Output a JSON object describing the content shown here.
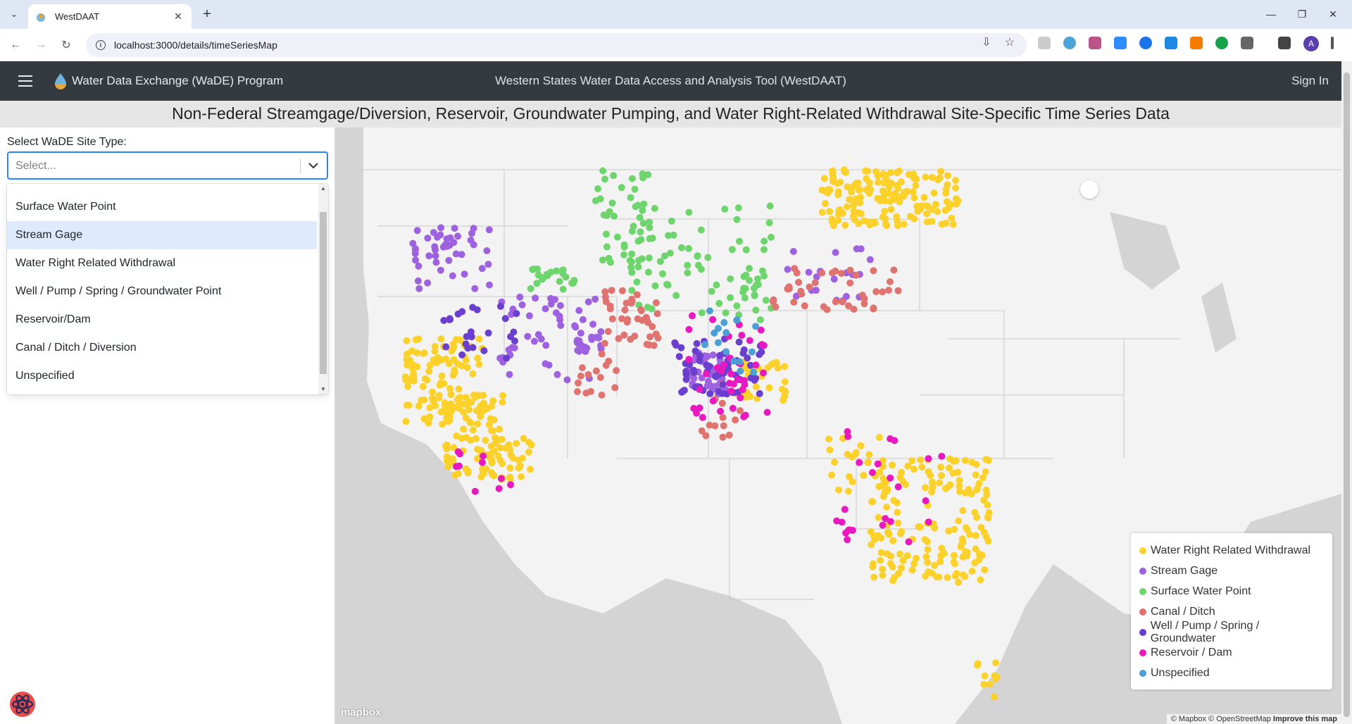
{
  "browser": {
    "tab_title": "WestDAAT",
    "url": "localhost:3000/details/timeSeriesMap",
    "profile_initial": "A"
  },
  "header": {
    "brand": "Water Data Exchange (WaDE) Program",
    "app_title": "Western States Water Data Access and Analysis Tool (WestDAAT)",
    "sign_in": "Sign In"
  },
  "page_title": "Non-Federal Streamgage/Diversion, Reservoir, Groundwater Pumping, and Water Right-Related Withdrawal Site-Specific Time Series Data",
  "filter": {
    "label": "Select WaDE Site Type:",
    "placeholder": "Select...",
    "options": [
      "Surface Water Point",
      "Stream Gage",
      "Water Right Related Withdrawal",
      "Well / Pump / Spring / Groundwater Point",
      "Reservoir/Dam",
      "Canal / Ditch / Diversion",
      "Unspecified"
    ],
    "highlighted": "Stream Gage"
  },
  "legend": [
    {
      "label": "Water Right Related Withdrawal",
      "color": "#fcd12a"
    },
    {
      "label": "Stream Gage",
      "color": "#9e62e1"
    },
    {
      "label": "Surface Water Point",
      "color": "#6ed56c"
    },
    {
      "label": "Canal / Ditch",
      "color": "#e07370"
    },
    {
      "label": "Well / Pump / Spring / Groundwater",
      "color": "#6a3fcf"
    },
    {
      "label": "Reservoir / Dam",
      "color": "#ea18c0"
    },
    {
      "label": "Unspecified",
      "color": "#4a9fd4"
    }
  ],
  "map": {
    "logo": "mapbox",
    "attribution": "© Mapbox © OpenStreetMap",
    "improve": "Improve this map"
  }
}
